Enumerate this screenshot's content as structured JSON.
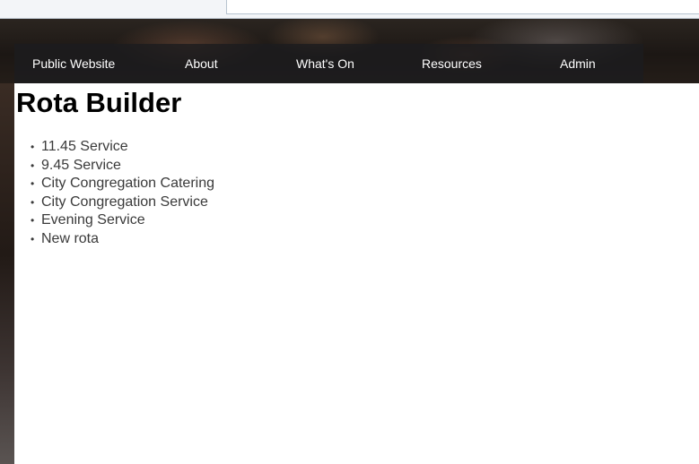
{
  "nav": {
    "items": [
      {
        "label": "Public Website"
      },
      {
        "label": "About"
      },
      {
        "label": "What's On"
      },
      {
        "label": "Resources"
      },
      {
        "label": "Admin"
      }
    ]
  },
  "page": {
    "title": "Rota Builder"
  },
  "rotas": [
    {
      "label": "11.45 Service"
    },
    {
      "label": "9.45 Service"
    },
    {
      "label": "City Congregation Catering"
    },
    {
      "label": "City Congregation Service"
    },
    {
      "label": "Evening Service"
    },
    {
      "label": "New rota"
    }
  ],
  "bullet_glyph": "•"
}
